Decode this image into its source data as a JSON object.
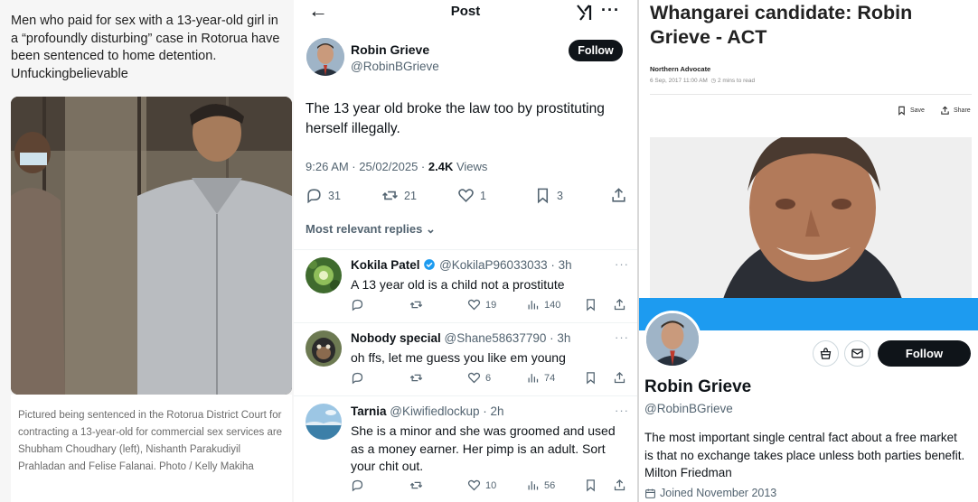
{
  "left_panel": {
    "headline": "Men who paid for sex with a 13-year-old girl in a “profoundly disturbing” case in Rotorua have been sentenced to home detention.",
    "comment": "Unfuckingbelievable",
    "photo_caption": "Pictured being sentenced in the Rotorua District Court for contracting a 13-year-old for commercial sex services are Shubham Choudhary (left), Nishanth Parakudiyil Prahladan and Felise Falanai. Photo / Kelly Makiha"
  },
  "post_view": {
    "header_title": "Post",
    "back_icon": "back-arrow-icon",
    "author": {
      "name": "Robin Grieve",
      "handle": "@RobinBGrieve",
      "follow_label": "Follow"
    },
    "text": "The 13 year old broke the law too by prostituting herself illegally.",
    "time": "9:26 AM · 25/02/2025 · ",
    "views_count": "2.4K",
    "views_label": " Views",
    "stats": {
      "replies": "31",
      "reposts": "21",
      "likes": "1",
      "bookmarks": "3"
    },
    "sort_label": "Most relevant replies",
    "replies": [
      {
        "name": "Kokila Patel",
        "verified": true,
        "handle_time": "@KokilaP96033033 · 3h",
        "text": "A 13 year old is a child not a prostitute",
        "likes": "19",
        "views": "140"
      },
      {
        "name": "Nobody special",
        "verified": false,
        "handle_time": "@Shane58637790 · 3h",
        "text": "oh ffs, let me guess you like em young",
        "likes": "6",
        "views": "74"
      },
      {
        "name": "Tarnia",
        "verified": false,
        "handle_time": "@Kiwifiedlockup · 2h",
        "text": "She is a minor and she was groomed and used as a money earner.  Her pimp is an adult.  Sort your chit out.",
        "likes": "10",
        "views": "56"
      }
    ]
  },
  "right_panel": {
    "article_title": "Whangarei candidate: Robin Grieve - ACT",
    "publication": "Northern Advocate",
    "published": "6 Sep, 2017 11:00 AM",
    "read_time": "2 mins to read",
    "save_label": "Save",
    "share_label": "Share",
    "profile": {
      "name": "Robin Grieve",
      "handle": "@RobinBGrieve",
      "follow_label": "Follow",
      "bio": "The most important single central fact about a free market is that no exchange takes place unless both parties benefit. Milton Friedman",
      "joined": "Joined November 2013"
    }
  },
  "colors": {
    "x_text": "#0f1419",
    "x_secondary": "#536471",
    "x_blue": "#1d9bf0"
  }
}
